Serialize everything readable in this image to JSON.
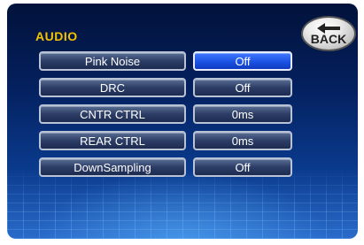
{
  "screen": {
    "title": "AUDIO",
    "back_label": "BACK"
  },
  "settings": [
    {
      "label": "Pink Noise",
      "value": "Off",
      "selected": true
    },
    {
      "label": "DRC",
      "value": "Off",
      "selected": false
    },
    {
      "label": "CNTR CTRL",
      "value": "0ms",
      "selected": false
    },
    {
      "label": "REAR CTRL",
      "value": "0ms",
      "selected": false
    },
    {
      "label": "DownSampling",
      "value": "Off",
      "selected": false
    }
  ],
  "colors": {
    "title": "#f5c400",
    "selected_value": "#1a4fe0",
    "button_text": "#ffffff"
  },
  "icons": {
    "back": "back-arrow-icon"
  }
}
